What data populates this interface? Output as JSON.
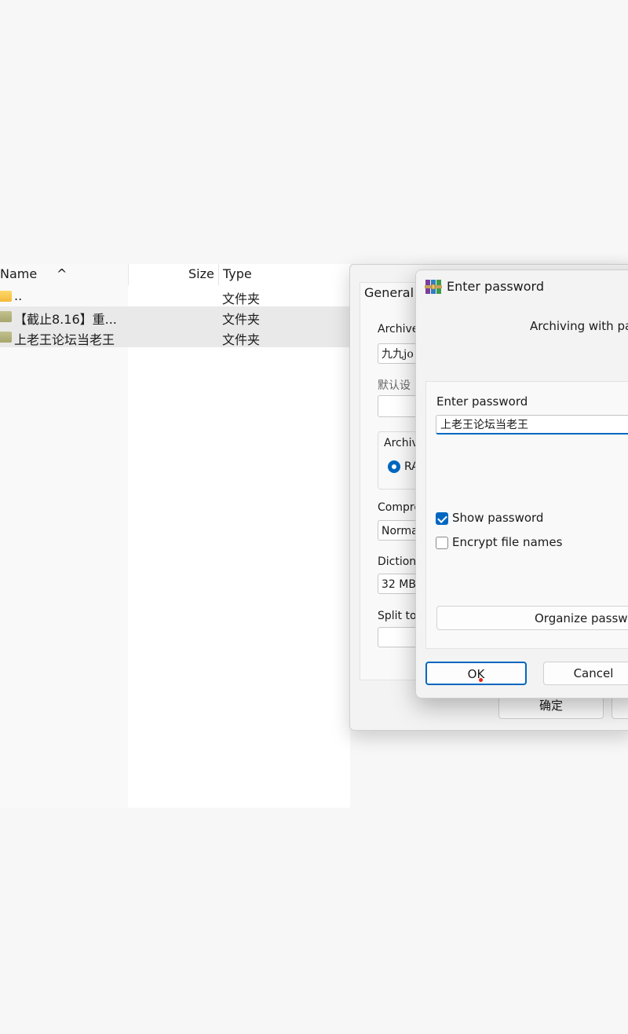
{
  "explorer": {
    "headers": {
      "name": "Name",
      "size": "Size",
      "type": "Type"
    },
    "rows": [
      {
        "name": "..",
        "type": "文件夹"
      },
      {
        "name": "【截止8.16】重...",
        "type": "文件夹"
      },
      {
        "name": "上老王论坛当老王",
        "type": "文件夹"
      }
    ]
  },
  "archive_dialog": {
    "tab": "General",
    "archive_name_label": "Archive",
    "archive_name_value": "九九jo",
    "profile_label": "默认设",
    "format_group_label": "Archiv",
    "format_option": "RA",
    "compression_label": "Compre",
    "compression_value": "Norma",
    "dictionary_label": "Dictiona",
    "dictionary_value": "32 MB",
    "split_label": "Split to",
    "ok_label": "确定"
  },
  "password_dialog": {
    "title": "Enter password",
    "subtitle": "Archiving with pas",
    "enter_password_label": "Enter password",
    "password_value": "上老王论坛当老王",
    "show_password_label": "Show password",
    "show_password_checked": true,
    "encrypt_names_label": "Encrypt file names",
    "encrypt_names_checked": false,
    "organize_label": "Organize passwor",
    "ok_label": "OK",
    "cancel_label": "Cancel"
  }
}
